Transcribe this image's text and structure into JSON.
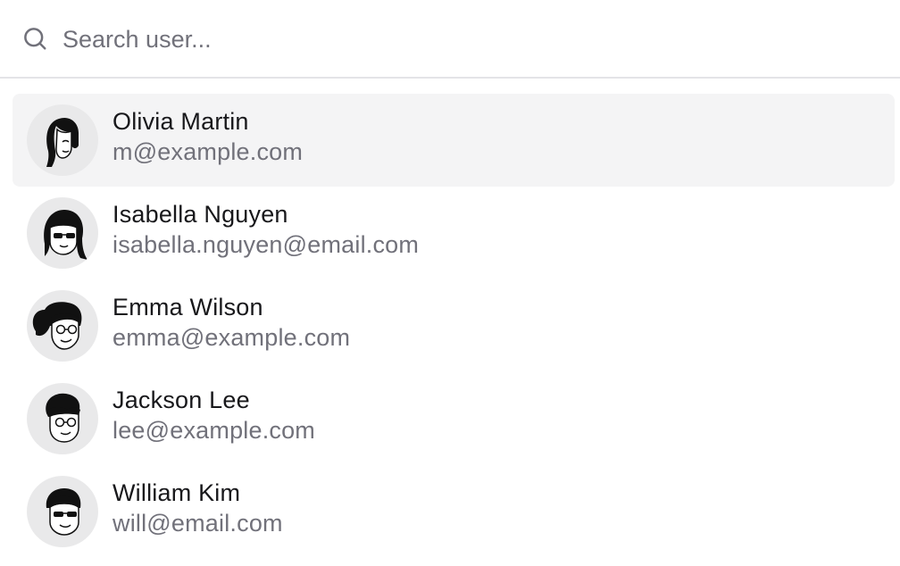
{
  "search": {
    "placeholder": "Search user...",
    "value": "",
    "icon": "search-icon"
  },
  "users": [
    {
      "name": "Olivia Martin",
      "email": "m@example.com",
      "selected": true,
      "avatar": "woman-long-hair-avatar"
    },
    {
      "name": "Isabella Nguyen",
      "email": "isabella.nguyen@email.com",
      "selected": false,
      "avatar": "woman-sunglasses-avatar"
    },
    {
      "name": "Emma Wilson",
      "email": "emma@example.com",
      "selected": false,
      "avatar": "woman-ponytail-glasses-avatar"
    },
    {
      "name": "Jackson Lee",
      "email": "lee@example.com",
      "selected": false,
      "avatar": "man-glasses-avatar"
    },
    {
      "name": "William Kim",
      "email": "will@email.com",
      "selected": false,
      "avatar": "man-sunglasses-avatar"
    }
  ],
  "colors": {
    "selected_bg": "#f4f4f5",
    "avatar_bg": "#e9e9ea",
    "muted_text": "#71717a",
    "primary_text": "#18181b",
    "divider": "#e4e4e7"
  }
}
